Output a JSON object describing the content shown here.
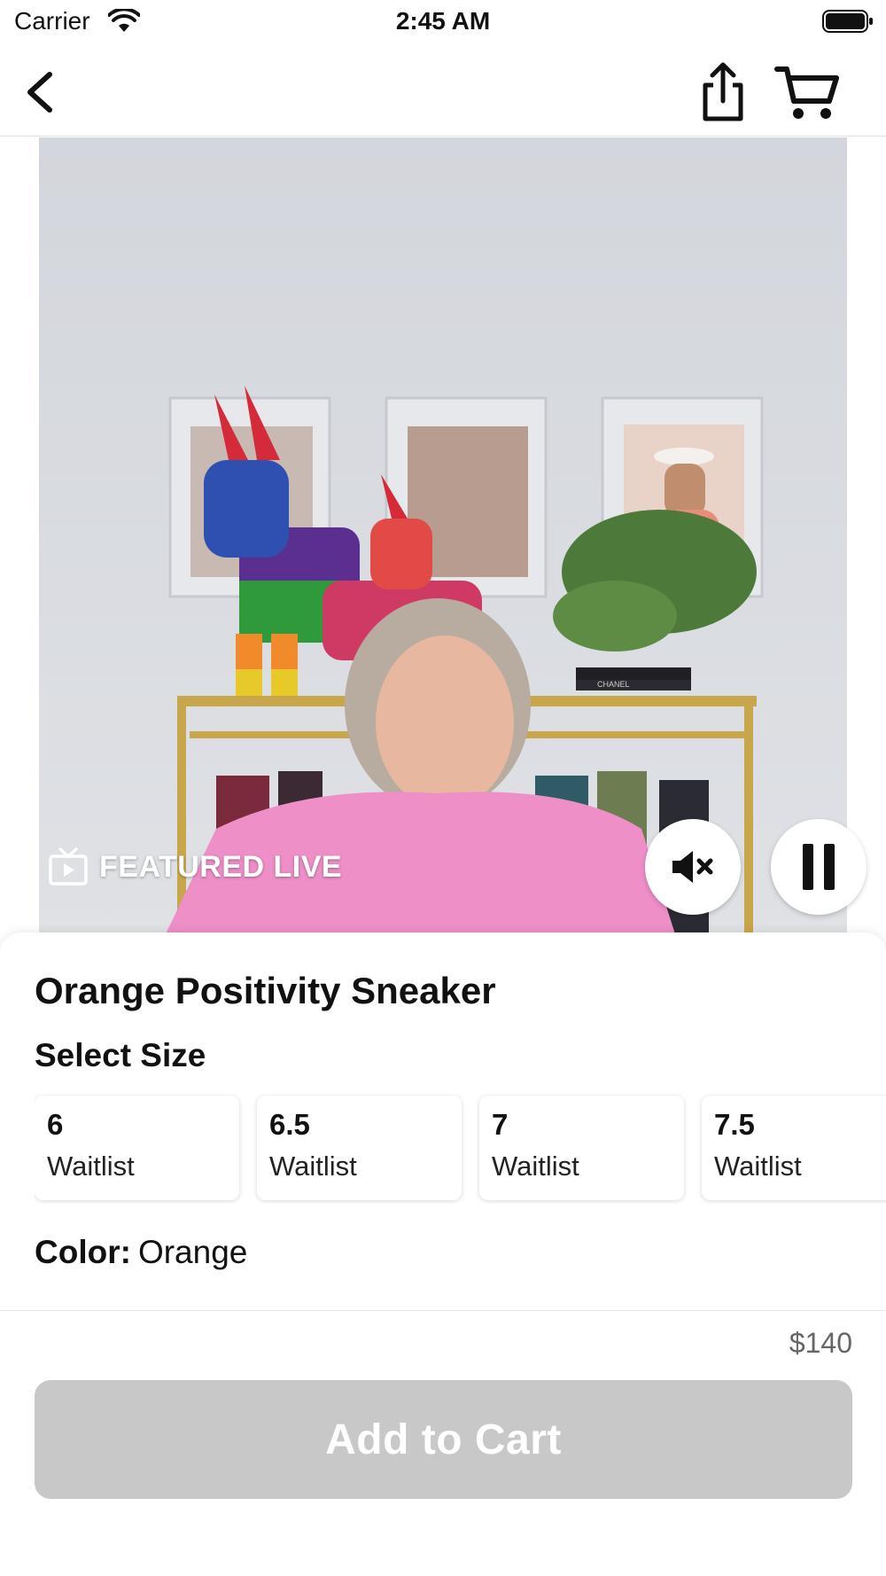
{
  "status_bar": {
    "carrier": "Carrier",
    "time": "2:45 AM",
    "wifi_icon": "wifi-icon",
    "battery_icon": "battery-full-icon"
  },
  "nav": {
    "back_icon": "chevron-left-icon",
    "share_icon": "share-icon",
    "cart_icon": "cart-icon"
  },
  "video": {
    "badge_text": "FEATURED LIVE",
    "badge_icon": "tv-icon",
    "mute_icon": "speaker-muted-icon",
    "pause_icon": "pause-icon",
    "shelf_book_text": "CHANEL"
  },
  "product": {
    "title": "Orange Positivity Sneaker",
    "size_heading": "Select Size",
    "sizes": [
      {
        "size": "6",
        "status": "Waitlist"
      },
      {
        "size": "6.5",
        "status": "Waitlist"
      },
      {
        "size": "7",
        "status": "Waitlist"
      },
      {
        "size": "7.5",
        "status": "Waitlist"
      }
    ],
    "color_label": "Color:",
    "color_value": "Orange"
  },
  "checkout": {
    "price": "$140",
    "add_to_cart_label": "Add to Cart",
    "button_color": "#c8c8c8"
  }
}
